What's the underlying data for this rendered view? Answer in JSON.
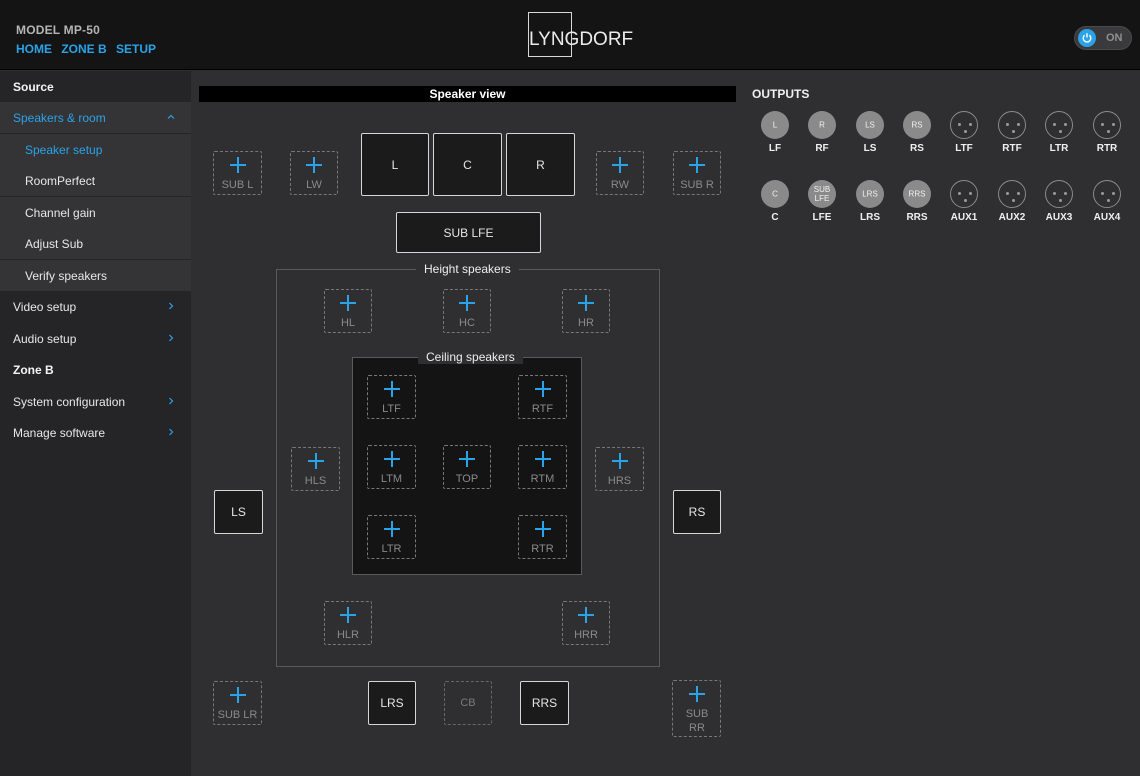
{
  "header": {
    "model": "MODEL MP-50",
    "crumbs": [
      "HOME",
      "ZONE B",
      "SETUP"
    ],
    "logo_text": "LYNGDORF",
    "power_label": "ON"
  },
  "sidebar": {
    "source": "Source",
    "speakers_room": "Speakers & room",
    "speaker_setup": "Speaker setup",
    "roomperfect": "RoomPerfect",
    "channel_gain": "Channel gain",
    "adjust_sub": "Adjust Sub",
    "verify_speakers": "Verify speakers",
    "video_setup": "Video setup",
    "audio_setup": "Audio setup",
    "zone_b": "Zone B",
    "system_configuration": "System configuration",
    "manage_software": "Manage software"
  },
  "speaker_view": {
    "title": "Speaker view",
    "front": {
      "l": "L",
      "c": "C",
      "r": "R",
      "sub_lfe": "SUB LFE"
    },
    "front_add": {
      "sub_l": "SUB L",
      "lw": "LW",
      "rw": "RW",
      "sub_r": "SUB R"
    },
    "height_title": "Height speakers",
    "height": {
      "hl": "HL",
      "hc": "HC",
      "hr": "HR",
      "hls": "HLS",
      "hrs": "HRS",
      "hlr": "HLR",
      "hrr": "HRR"
    },
    "ceiling_title": "Ceiling speakers",
    "ceiling": {
      "ltf": "LTF",
      "rtf": "RTF",
      "ltm": "LTM",
      "top": "TOP",
      "rtm": "RTM",
      "ltr": "LTR",
      "rtr": "RTR"
    },
    "side": {
      "ls": "LS",
      "rs": "RS"
    },
    "rear": {
      "sub_lr": "SUB LR",
      "lrs": "LRS",
      "cb": "CB",
      "rrs": "RRS",
      "sub_rr": "SUB RR"
    }
  },
  "outputs": {
    "title": "OUTPUTS",
    "row1": [
      {
        "name": "LF",
        "inner": "L",
        "type": "filled"
      },
      {
        "name": "RF",
        "inner": "R",
        "type": "filled"
      },
      {
        "name": "LS",
        "inner": "LS",
        "type": "filled"
      },
      {
        "name": "RS",
        "inner": "RS",
        "type": "filled"
      },
      {
        "name": "LTF",
        "inner": "",
        "type": "empty"
      },
      {
        "name": "RTF",
        "inner": "",
        "type": "empty"
      },
      {
        "name": "LTR",
        "inner": "",
        "type": "empty"
      },
      {
        "name": "RTR",
        "inner": "",
        "type": "empty"
      }
    ],
    "row2": [
      {
        "name": "C",
        "inner": "C",
        "type": "filled"
      },
      {
        "name": "LFE",
        "inner": "SUB LFE",
        "type": "filled"
      },
      {
        "name": "LRS",
        "inner": "LRS",
        "type": "filled"
      },
      {
        "name": "RRS",
        "inner": "RRS",
        "type": "filled"
      },
      {
        "name": "AUX1",
        "inner": "",
        "type": "empty"
      },
      {
        "name": "AUX2",
        "inner": "",
        "type": "empty"
      },
      {
        "name": "AUX3",
        "inner": "",
        "type": "empty"
      },
      {
        "name": "AUX4",
        "inner": "",
        "type": "empty"
      }
    ]
  }
}
